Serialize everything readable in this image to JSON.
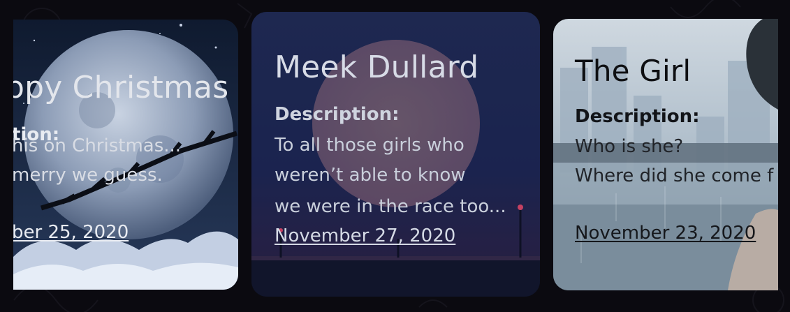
{
  "cards": [
    {
      "title": "ppy Christmas",
      "description_label": "tion:",
      "description_lines": [
        "his on Christmas...",
        "merry we guess."
      ],
      "date": "ber 25, 2020"
    },
    {
      "title": "Meek Dullard",
      "description_label": "Description:",
      "description_lines": [
        "To all those girls who",
        "weren’t able to know",
        "we were in the race too..."
      ],
      "date": "November 27, 2020"
    },
    {
      "title": "The Girl",
      "description_label": "Description:",
      "description_lines": [
        "Who is she?",
        "Where did she come f"
      ],
      "date": "November 23, 2020"
    }
  ],
  "colors": {
    "page_background": "#0b0a10",
    "card1_sky": "#1c2c4a",
    "card2_overlay": "#1b2850",
    "card3_window": "#b7c6d1"
  }
}
